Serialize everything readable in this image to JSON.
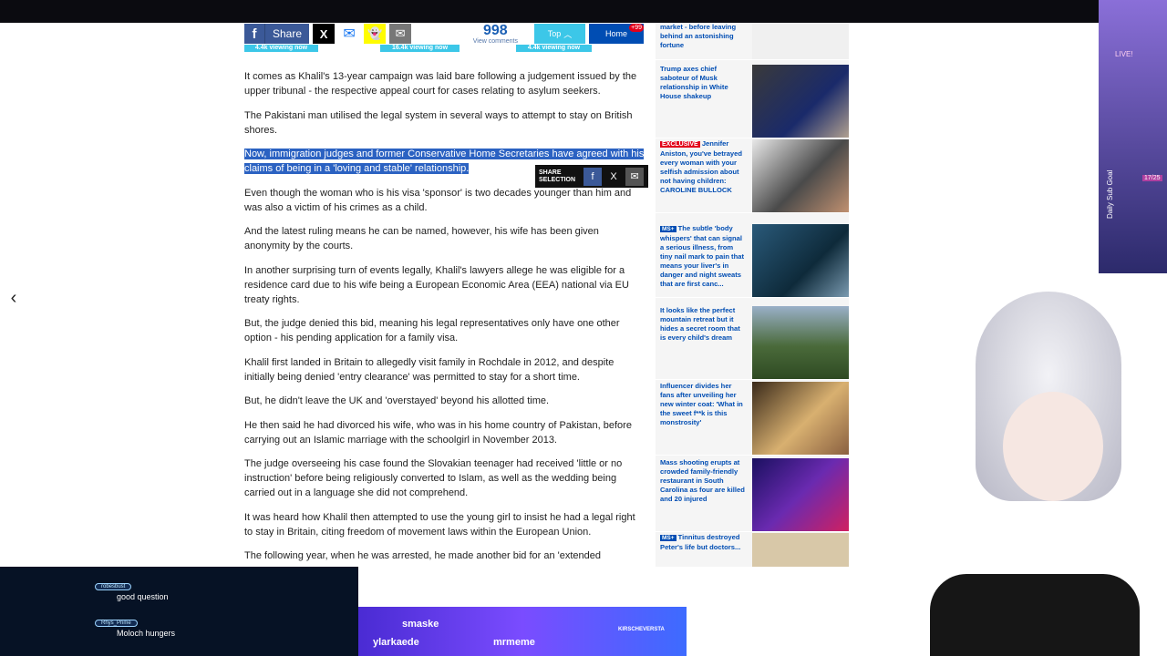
{
  "share_bar": {
    "share_label": "Share",
    "comments_count": "998",
    "comments_label": "View comments",
    "top_label": "Top",
    "home_label": "Home",
    "home_badge": "+99"
  },
  "viewing": [
    "4.4k viewing now",
    "16.4k viewing now",
    "4.4k viewing now"
  ],
  "article": {
    "paragraphs": [
      "It comes as Khalil's 13-year campaign was laid bare following a judgement issued by the upper tribunal - the respective appeal court for cases relating to asylum seekers.",
      "The Pakistani man utilised the legal system in several ways to attempt to stay on British shores.",
      "Now, immigration judges and former Conservative Home Secretaries have agreed with his claims of being in a 'loving and stable' relationship.",
      "Even though the woman who is his visa 'sponsor' is two decades younger than him and was also a victim of his crimes as a child.",
      "And the latest ruling means he can be named, however, his wife has been given anonymity by the courts.",
      "In another surprising turn of events legally, Khalil's lawyers allege he was eligible for a residence card due to his wife being a European Economic Area (EEA) national via EU treaty rights.",
      "But, the judge denied this bid, meaning his legal representatives only have one other option - his pending application for a family visa.",
      "Khalil first landed in Britain to allegedly visit family in Rochdale in 2012, and despite initially being denied 'entry clearance' was permitted to stay for a short time.",
      "But, he didn't leave the UK and 'overstayed' beyond his allotted time.",
      "He then said he had divorced his wife, who was in his home country of Pakistan, before carrying out an Islamic marriage with the schoolgirl in November 2013.",
      "The judge overseeing his case found the Slovakian teenager had received 'little or no instruction' before being religiously converted to Islam, as well as the wedding being carried out in a language she did not comprehend.",
      "It was heard how Khalil then attempted to use the young girl to insist he had a legal right to stay in Britain, citing freedom of movement laws within the European Union.",
      "The following year, when he was arrested, he made another bid for an 'extended"
    ]
  },
  "share_selection": {
    "label_line1": "SHARE",
    "label_line2": "SELECTION"
  },
  "sidebar": {
    "promos": [
      {
        "text": "market - before leaving behind an astonishing fortune"
      },
      {
        "text": "Trump axes chief saboteur of Musk relationship in White House shakeup"
      },
      {
        "badge": "EXCLUSIVE",
        "text": "Jennifer Aniston, you've betrayed every woman with your selfish admission about not having children: CAROLINE BULLOCK"
      },
      {
        "badge": "MS+",
        "text": "The subtle 'body whispers' that can signal a serious illness, from tiny nail mark to pain that means your liver's in danger and night sweats that are first canc..."
      },
      {
        "text": "It looks like the perfect mountain retreat but it hides a secret room that is every child's dream"
      },
      {
        "text": "Influencer divides her fans after unveiling her new winter coat: 'What in the sweet f**k is this monstrosity'"
      },
      {
        "text": "Mass shooting erupts at crowded family-friendly restaurant in South Carolina as four are killed and 20 injured"
      },
      {
        "badge": "MS+",
        "text": "Tinnitus destroyed Peter's life but doctors..."
      }
    ]
  },
  "chat": [
    {
      "user": "robesbust",
      "msg": "good question"
    },
    {
      "user": "Rhys_Prime",
      "msg": "Moloch hungers"
    }
  ],
  "stream_bar": {
    "tags": [
      "smaske",
      "ylarkaede",
      "mrmeme"
    ],
    "kirsch": "KIRSCHEVERSTA"
  },
  "overlay": {
    "goal_label": "Daily Sub Goal",
    "goal_count": "17/25",
    "live": "LIVE!"
  }
}
